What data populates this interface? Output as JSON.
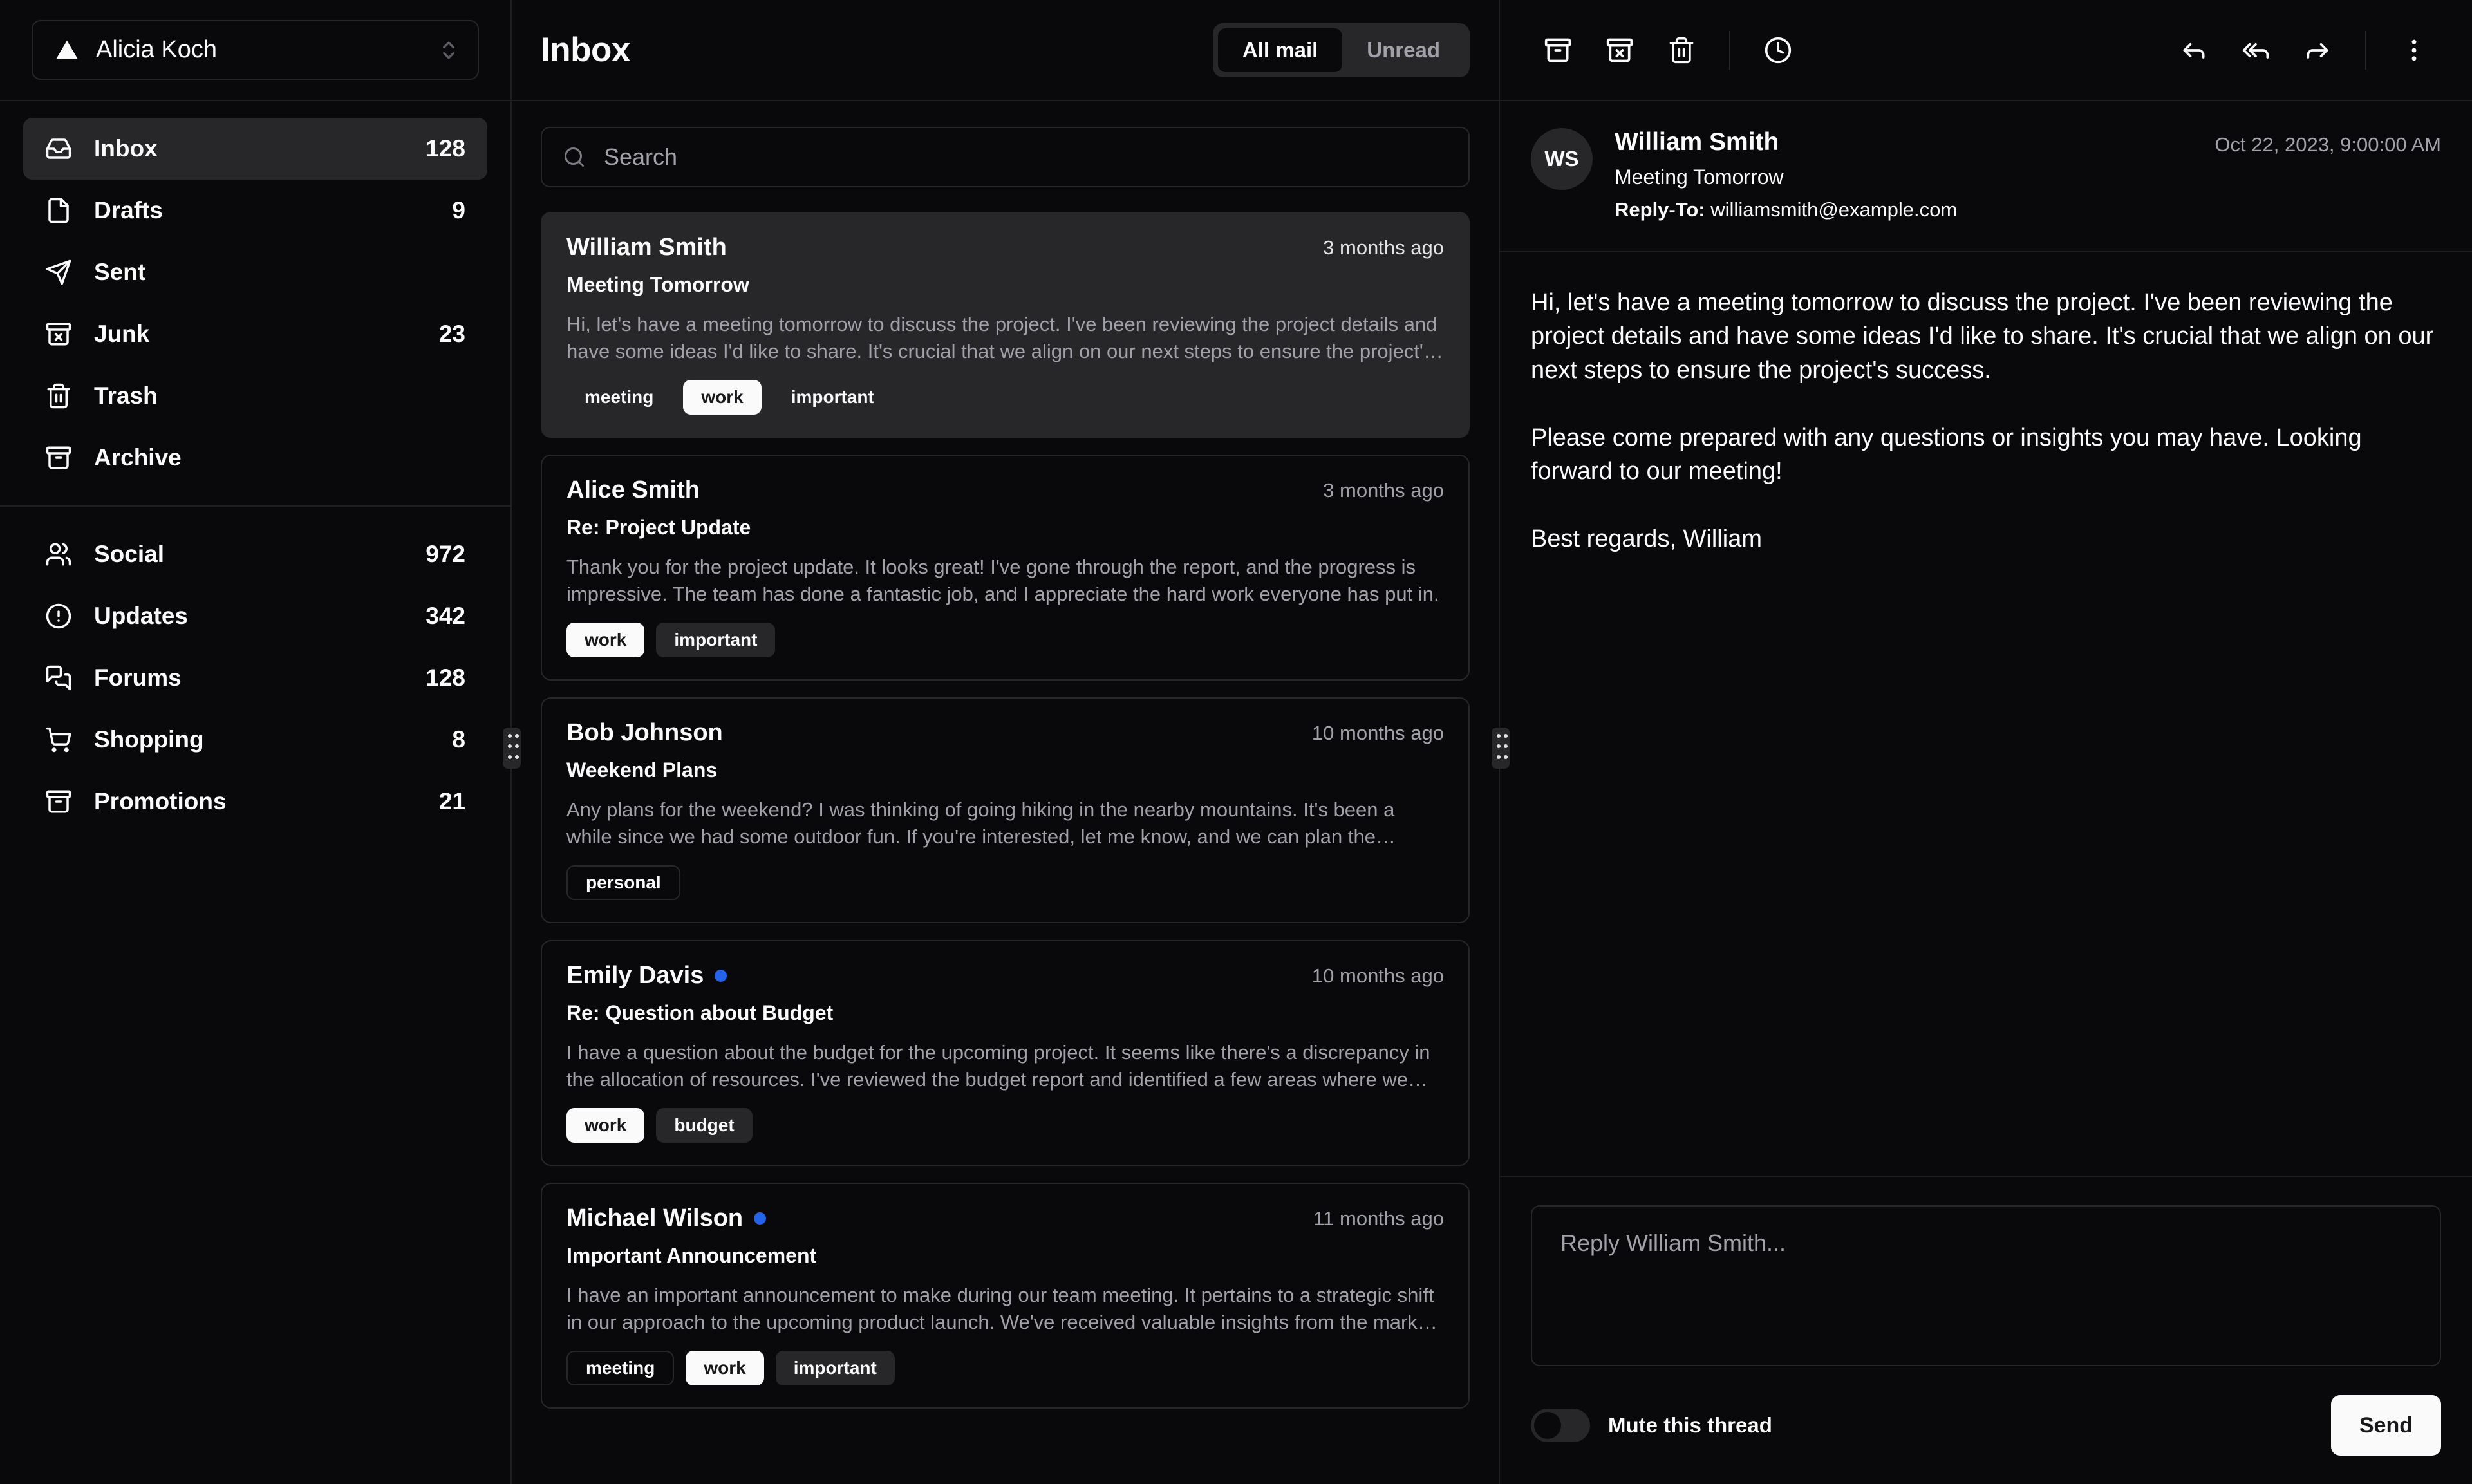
{
  "sidebar": {
    "account": {
      "name": "Alicia Koch",
      "logo_icon": "triangle-logo-icon",
      "chevron_icon": "chevrons-up-down-icon"
    },
    "groups": [
      {
        "items": [
          {
            "label": "Inbox",
            "count": "128",
            "icon": "inbox-icon",
            "active": true
          },
          {
            "label": "Drafts",
            "count": "9",
            "icon": "file-icon",
            "active": false
          },
          {
            "label": "Sent",
            "count": "",
            "icon": "send-icon",
            "active": false
          },
          {
            "label": "Junk",
            "count": "23",
            "icon": "archive-x-icon",
            "active": false
          },
          {
            "label": "Trash",
            "count": "",
            "icon": "trash-icon",
            "active": false
          },
          {
            "label": "Archive",
            "count": "",
            "icon": "archive-icon",
            "active": false
          }
        ]
      },
      {
        "items": [
          {
            "label": "Social",
            "count": "972",
            "icon": "users-icon",
            "active": false
          },
          {
            "label": "Updates",
            "count": "342",
            "icon": "alert-circle-icon",
            "active": false
          },
          {
            "label": "Forums",
            "count": "128",
            "icon": "messages-icon",
            "active": false
          },
          {
            "label": "Shopping",
            "count": "8",
            "icon": "shopping-cart-icon",
            "active": false
          },
          {
            "label": "Promotions",
            "count": "21",
            "icon": "archive-icon",
            "active": false
          }
        ]
      }
    ]
  },
  "list": {
    "title": "Inbox",
    "tabs": [
      {
        "label": "All mail",
        "selected": true
      },
      {
        "label": "Unread",
        "selected": false
      }
    ],
    "search": {
      "placeholder": "Search",
      "value": "",
      "icon": "search-icon"
    },
    "emails": [
      {
        "from": "William Smith",
        "date": "3 months ago",
        "subject": "Meeting Tomorrow",
        "preview": "Hi, let's have a meeting tomorrow to discuss the project. I've been reviewing the project details and have some ideas I'd like to share. It's crucial that we align on our next steps to ensure the project's success.",
        "unread": false,
        "selected": true,
        "badges": [
          {
            "label": "meeting",
            "variant": "secondary"
          },
          {
            "label": "work",
            "variant": "default"
          },
          {
            "label": "important",
            "variant": "secondary"
          }
        ]
      },
      {
        "from": "Alice Smith",
        "date": "3 months ago",
        "subject": "Re: Project Update",
        "preview": "Thank you for the project update. It looks great! I've gone through the report, and the progress is impressive. The team has done a fantastic job, and I appreciate the hard work everyone has put in.",
        "unread": false,
        "selected": false,
        "badges": [
          {
            "label": "work",
            "variant": "default"
          },
          {
            "label": "important",
            "variant": "secondary"
          }
        ]
      },
      {
        "from": "Bob Johnson",
        "date": "10 months ago",
        "subject": "Weekend Plans",
        "preview": "Any plans for the weekend? I was thinking of going hiking in the nearby mountains. It's been a while since we had some outdoor fun. If you're interested, let me know, and we can plan the details.",
        "unread": false,
        "selected": false,
        "badges": [
          {
            "label": "personal",
            "variant": "outline"
          }
        ]
      },
      {
        "from": "Emily Davis",
        "date": "10 months ago",
        "subject": "Re: Question about Budget",
        "preview": "I have a question about the budget for the upcoming project. It seems like there's a discrepancy in the allocation of resources. I've reviewed the budget report and identified a few areas where we might be able to optimize.",
        "unread": true,
        "selected": false,
        "badges": [
          {
            "label": "work",
            "variant": "default"
          },
          {
            "label": "budget",
            "variant": "secondary"
          }
        ]
      },
      {
        "from": "Michael Wilson",
        "date": "11 months ago",
        "subject": "Important Announcement",
        "preview": "I have an important announcement to make during our team meeting. It pertains to a strategic shift in our approach to the upcoming product launch. We've received valuable insights from the market research team.",
        "unread": true,
        "selected": false,
        "badges": [
          {
            "label": "meeting",
            "variant": "outline"
          },
          {
            "label": "work",
            "variant": "default"
          },
          {
            "label": "important",
            "variant": "secondary"
          }
        ]
      }
    ]
  },
  "reader": {
    "toolbar_left": [
      {
        "name": "archive-icon",
        "title": "Archive"
      },
      {
        "name": "archive-x-icon",
        "title": "Move to junk"
      },
      {
        "name": "trash-icon",
        "title": "Move to trash"
      },
      {
        "name": "clock-icon",
        "title": "Snooze"
      }
    ],
    "toolbar_right": [
      {
        "name": "reply-icon",
        "title": "Reply"
      },
      {
        "name": "reply-all-icon",
        "title": "Reply all"
      },
      {
        "name": "forward-icon",
        "title": "Forward"
      },
      {
        "name": "more-vertical-icon",
        "title": "More"
      }
    ],
    "avatar_initials": "WS",
    "from": "William Smith",
    "subject": "Meeting Tomorrow",
    "reply_to_label": "Reply-To:",
    "reply_to_email": "williamsmith@example.com",
    "date": "Oct 22, 2023, 9:00:00 AM",
    "body": "Hi, let's have a meeting tomorrow to discuss the project. I've been reviewing the project details and have some ideas I'd like to share. It's crucial that we align on our next steps to ensure the project's success.\n\nPlease come prepared with any questions or insights you may have. Looking forward to our meeting!\n\nBest regards, William",
    "reply_placeholder": "Reply William Smith...",
    "reply_value": "",
    "mute_label": "Mute this thread",
    "mute_on": false,
    "send_label": "Send"
  },
  "colors": {
    "background": "#09090b",
    "border": "#27272a",
    "muted_foreground": "#a1a1aa",
    "accent": "#27272a",
    "unread_dot": "#2563eb",
    "primary": "#fafafa"
  }
}
